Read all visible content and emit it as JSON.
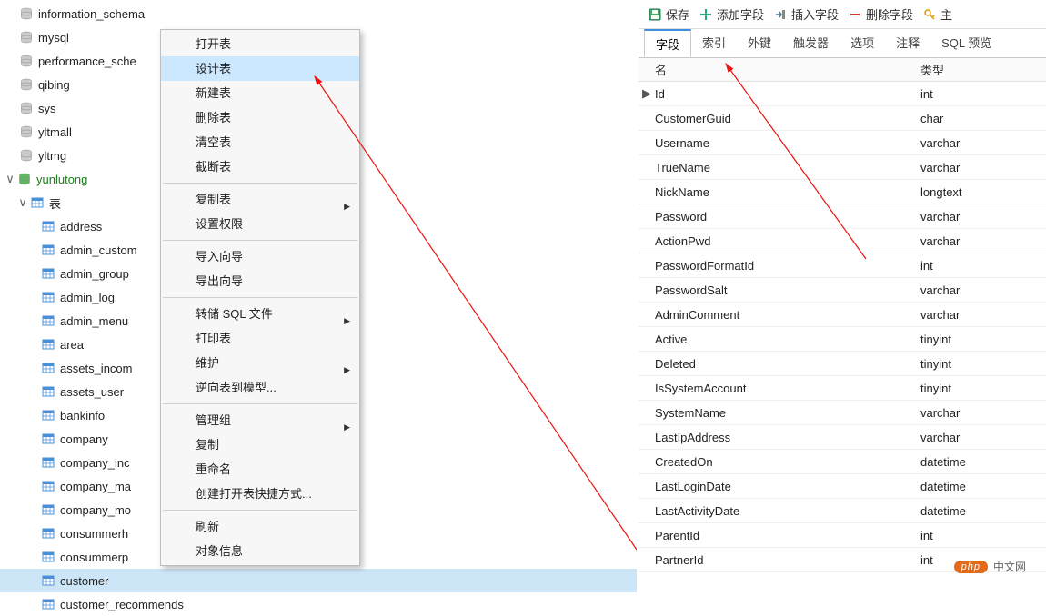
{
  "tree": {
    "databases": [
      {
        "name": "information_schema",
        "type": "db"
      },
      {
        "name": "mysql",
        "type": "db"
      },
      {
        "name": "performance_sche",
        "type": "db"
      },
      {
        "name": "qibing",
        "type": "db"
      },
      {
        "name": "sys",
        "type": "db"
      },
      {
        "name": "yltmall",
        "type": "db"
      },
      {
        "name": "yltmg",
        "type": "db"
      }
    ],
    "active_db": "yunlutong",
    "folder_label": "表",
    "tables": [
      "address",
      "admin_custom",
      "admin_group",
      "admin_log",
      "admin_menu",
      "area",
      "assets_incom",
      "assets_user",
      "bankinfo",
      "company",
      "company_inc",
      "company_ma",
      "company_mo",
      "consummerh",
      "consummerp",
      "customer",
      "customer_recommends"
    ],
    "selected_table": "customer"
  },
  "context_menu": {
    "items": [
      {
        "label": "打开表"
      },
      {
        "label": "设计表",
        "highlight": true
      },
      {
        "label": "新建表"
      },
      {
        "label": "删除表"
      },
      {
        "label": "清空表"
      },
      {
        "label": "截断表"
      },
      {
        "sep": true
      },
      {
        "label": "复制表",
        "arrow": true
      },
      {
        "label": "设置权限"
      },
      {
        "sep": true
      },
      {
        "label": "导入向导"
      },
      {
        "label": "导出向导"
      },
      {
        "sep": true
      },
      {
        "label": "转储 SQL 文件",
        "arrow": true
      },
      {
        "label": "打印表"
      },
      {
        "label": "维护",
        "arrow": true
      },
      {
        "label": "逆向表到模型..."
      },
      {
        "sep": true
      },
      {
        "label": "管理组",
        "arrow": true
      },
      {
        "label": "复制"
      },
      {
        "label": "重命名"
      },
      {
        "label": "创建打开表快捷方式..."
      },
      {
        "sep": true
      },
      {
        "label": "刷新"
      },
      {
        "label": "对象信息"
      }
    ]
  },
  "toolbar": {
    "save": "保存",
    "add_field": "添加字段",
    "insert_field": "插入字段",
    "delete_field": "删除字段",
    "primary": "主"
  },
  "tabs": [
    "字段",
    "索引",
    "外键",
    "触发器",
    "选项",
    "注释",
    "SQL 预览"
  ],
  "tabs_active": 0,
  "columns": {
    "c1": "名",
    "c2": "类型"
  },
  "fields": [
    {
      "name": "Id",
      "type": "int",
      "current": true
    },
    {
      "name": "CustomerGuid",
      "type": "char"
    },
    {
      "name": "Username",
      "type": "varchar"
    },
    {
      "name": "TrueName",
      "type": "varchar"
    },
    {
      "name": "NickName",
      "type": "longtext"
    },
    {
      "name": "Password",
      "type": "varchar"
    },
    {
      "name": "ActionPwd",
      "type": "varchar"
    },
    {
      "name": "PasswordFormatId",
      "type": "int"
    },
    {
      "name": "PasswordSalt",
      "type": "varchar"
    },
    {
      "name": "AdminComment",
      "type": "varchar"
    },
    {
      "name": "Active",
      "type": "tinyint"
    },
    {
      "name": "Deleted",
      "type": "tinyint"
    },
    {
      "name": "IsSystemAccount",
      "type": "tinyint"
    },
    {
      "name": "SystemName",
      "type": "varchar"
    },
    {
      "name": "LastIpAddress",
      "type": "varchar"
    },
    {
      "name": "CreatedOn",
      "type": "datetime"
    },
    {
      "name": "LastLoginDate",
      "type": "datetime"
    },
    {
      "name": "LastActivityDate",
      "type": "datetime"
    },
    {
      "name": "ParentId",
      "type": "int"
    },
    {
      "name": "PartnerId",
      "type": "int"
    }
  ],
  "watermark": {
    "pill": "php",
    "text": "中文网"
  }
}
